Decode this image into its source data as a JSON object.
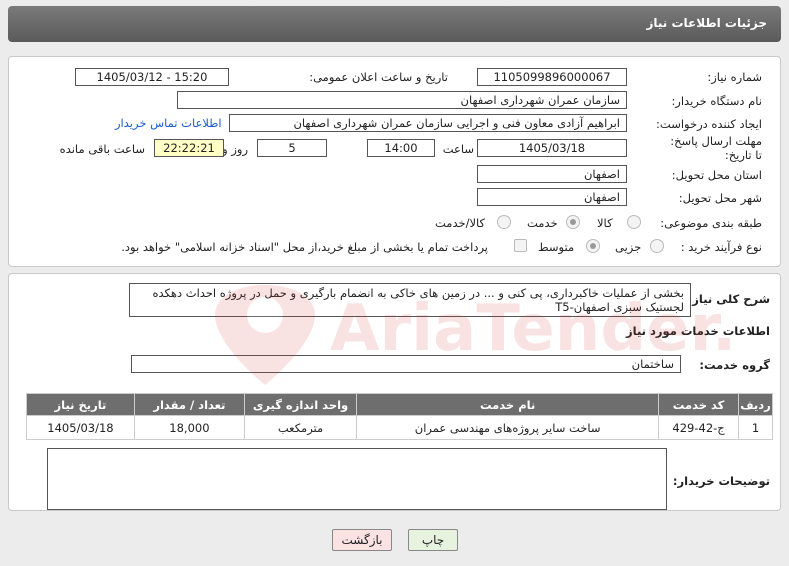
{
  "window": {
    "title": "جزئیات اطلاعات نیاز"
  },
  "form": {
    "need_number_label": "شماره نیاز:",
    "need_number": "1105099896000067",
    "announce_label": "تاریخ و ساعت اعلان عمومی:",
    "announce_value": "1405/03/12 - 15:20",
    "buyer_label": "نام دستگاه خریدار:",
    "buyer_value": "سازمان عمران شهرداری اصفهان",
    "creator_label": "ایجاد کننده درخواست:",
    "creator_value": "ابراهیم آزادی معاون فنی و اجرایی سازمان عمران شهرداری اصفهان",
    "contact_link": "اطلاعات تماس خریدار",
    "deadline_label": "مهلت ارسال پاسخ: تا تاریخ:",
    "deadline_date": "1405/03/18",
    "time_label": "ساعت",
    "deadline_time": "14:00",
    "days_value": "5",
    "days_label": "روز و",
    "remaining_time": "22:22:21",
    "remaining_label": "ساعت باقی مانده",
    "province_label": "استان محل تحویل:",
    "province_value": "اصفهان",
    "city_label": "شهر محل تحویل:",
    "city_value": "اصفهان",
    "category_label": "طبقه بندی موضوعی:",
    "category_options": [
      "کالا",
      "خدمت",
      "کالا/خدمت"
    ],
    "category_selected": "خدمت",
    "process_label": "نوع فرآیند خرید :",
    "process_options": [
      "جزیی",
      "متوسط"
    ],
    "process_selected": "متوسط",
    "payment_note": "پرداخت تمام یا بخشی از مبلغ خرید،از محل \"اسناد خزانه اسلامی\" خواهد بود."
  },
  "details": {
    "summary_label": "شرح کلی نیاز:",
    "summary_text": "بخشی از عملیات خاکبرداری، پی کنی  و ... در زمین های خاکی به انضمام بارگیری و حمل در پروژه احداث دهکده لجستیک سبزی اصفهان-T5",
    "services_title": "اطلاعات خدمات مورد نیاز",
    "service_group_label": "گروه خدمت:",
    "service_group_value": "ساختمان",
    "table": {
      "headers": [
        "ردیف",
        "کد خدمت",
        "نام خدمت",
        "واحد اندازه گیری",
        "تعداد / مقدار",
        "تاریخ نیاز"
      ],
      "rows": [
        [
          "1",
          "ج-42-429",
          "ساخت سایر پروژه‌های مهندسی عمران",
          "مترمکعب",
          "18,000",
          "1405/03/18"
        ]
      ]
    },
    "buyer_notes_label": "توضیحات خریدار:",
    "buyer_notes_value": ""
  },
  "buttons": {
    "print": "چاپ",
    "back": "بازگشت"
  },
  "watermark_text": "AriaTender.net"
}
